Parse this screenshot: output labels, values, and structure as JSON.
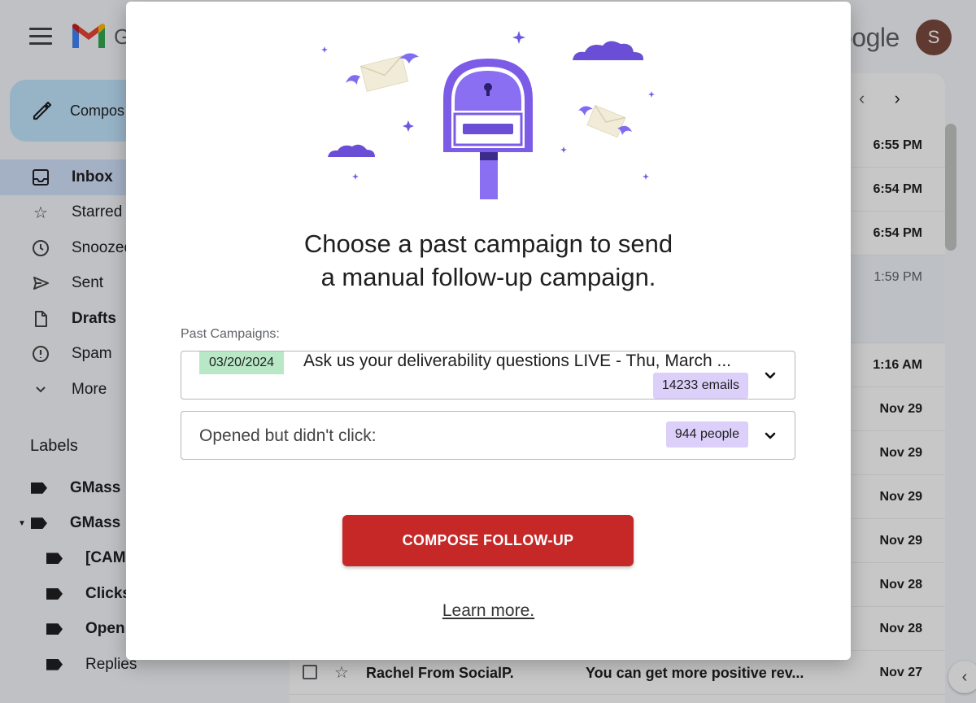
{
  "gmail": {
    "app_name": "G",
    "brand_text": "oogle",
    "avatar_initial": "S",
    "compose_label": "Compos",
    "nav": [
      {
        "label": "Inbox",
        "icon": "inbox-icon"
      },
      {
        "label": "Starred",
        "icon": "star-icon"
      },
      {
        "label": "Snoozed",
        "icon": "clock-icon"
      },
      {
        "label": "Sent",
        "icon": "send-icon"
      },
      {
        "label": "Drafts",
        "icon": "draft-icon"
      },
      {
        "label": "Spam",
        "icon": "spam-icon"
      },
      {
        "label": "More",
        "icon": "chevron-down-icon"
      }
    ],
    "labels_heading": "Labels",
    "labels": [
      {
        "label": "GMass"
      },
      {
        "label": "GMass"
      },
      {
        "label": "[CAM"
      },
      {
        "label": "Clicks"
      },
      {
        "label": "Open"
      },
      {
        "label": "Replies"
      }
    ],
    "pager": {
      "prev": "‹",
      "next": "›"
    },
    "rows": [
      {
        "time": "6:55 PM"
      },
      {
        "time": "6:54 PM"
      },
      {
        "time": "6:54 PM"
      },
      {
        "time": "1:59 PM"
      },
      {
        "time": "1:16 AM"
      },
      {
        "time": "Nov 29"
      },
      {
        "time": "Nov 29"
      },
      {
        "time": "Nov 29"
      },
      {
        "time": "Nov 29"
      },
      {
        "time": "Nov 28"
      },
      {
        "time": "Nov 28"
      },
      {
        "time": "Nov 27",
        "sender": "Rachel From SocialP.",
        "subject": "You can get more positive rev..."
      }
    ]
  },
  "modal": {
    "headline_line1": "Choose a past campaign to send",
    "headline_line2": "a manual follow-up campaign.",
    "field_label": "Past Campaigns:",
    "campaign": {
      "date": "03/20/2024",
      "title": "Ask us your deliverability questions LIVE - Thu, March ...",
      "count": "14233 emails"
    },
    "segment": {
      "label": "Opened but didn't click:",
      "count": "944 people"
    },
    "cta_label": "COMPOSE FOLLOW-UP",
    "learn_more": "Learn more.",
    "colors": {
      "cta": "#c62828",
      "date_chip": "#b9e8c7",
      "count_chip": "#dccffa",
      "mailbox": "#7c5ce6"
    }
  }
}
